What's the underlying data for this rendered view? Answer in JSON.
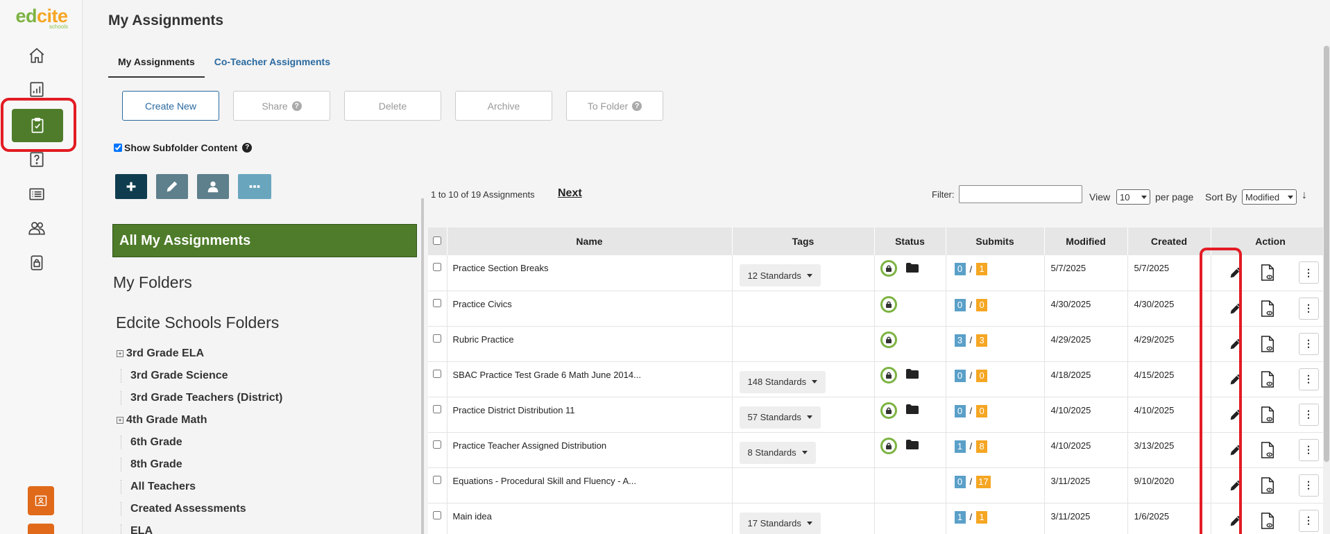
{
  "logo": {
    "part1": "ed",
    "part2": "cite",
    "sub": "schools"
  },
  "page_title": "My Assignments",
  "tabs": [
    {
      "label": "My Assignments"
    },
    {
      "label": "Co-Teacher Assignments"
    }
  ],
  "actions": {
    "create_new": "Create New",
    "share": "Share",
    "delete": "Delete",
    "archive": "Archive",
    "to_folder": "To Folder"
  },
  "subfolder": {
    "label": "Show Subfolder Content",
    "checked": true
  },
  "tools": [
    {
      "icon": "plus-icon",
      "color": "#0f3d4f"
    },
    {
      "icon": "pencil-icon",
      "color": "#5e7f8c"
    },
    {
      "icon": "user-icon",
      "color": "#5e7f8c"
    },
    {
      "icon": "more-icon",
      "color": "#6aa5be"
    }
  ],
  "folders": {
    "all_label": "All My Assignments",
    "my_folders": "My Folders",
    "school_folders": "Edcite Schools Folders",
    "items": [
      {
        "label": "3rd Grade ELA",
        "expandable": true
      },
      {
        "label": "3rd Grade Science",
        "expandable": false
      },
      {
        "label": "3rd Grade Teachers (District)",
        "expandable": false
      },
      {
        "label": "4th Grade Math",
        "expandable": true
      },
      {
        "label": "6th Grade",
        "expandable": false
      },
      {
        "label": "8th Grade",
        "expandable": false
      },
      {
        "label": "All Teachers",
        "expandable": false
      },
      {
        "label": "Created Assessments",
        "expandable": false
      },
      {
        "label": "ELA",
        "expandable": false
      }
    ]
  },
  "pager": {
    "summary": "1 to 10 of 19 Assignments",
    "next": "Next",
    "filter_label": "Filter:",
    "view_label": "View",
    "view_value": "10",
    "per_page": "per page",
    "sort_label": "Sort By",
    "sort_value": "Modified",
    "sort_arrow": "↓"
  },
  "table": {
    "headers": [
      "Name",
      "Tags",
      "Status",
      "Submits",
      "Modified",
      "Created",
      "Action"
    ],
    "rows": [
      {
        "name": "Practice Section Breaks",
        "tags": "12 Standards",
        "lock": true,
        "folder": true,
        "sub_a": "0",
        "sub_b": "1",
        "modified": "5/7/2025",
        "created": "5/7/2025"
      },
      {
        "name": "Practice Civics",
        "tags": "",
        "lock": true,
        "folder": false,
        "sub_a": "0",
        "sub_b": "0",
        "modified": "4/30/2025",
        "created": "4/30/2025"
      },
      {
        "name": "Rubric Practice",
        "tags": "",
        "lock": true,
        "folder": false,
        "sub_a": "3",
        "sub_b": "3",
        "modified": "4/29/2025",
        "created": "4/29/2025"
      },
      {
        "name": "SBAC Practice Test Grade 6 Math June 2014...",
        "tags": "148 Standards",
        "lock": true,
        "folder": true,
        "sub_a": "0",
        "sub_b": "0",
        "modified": "4/18/2025",
        "created": "4/15/2025"
      },
      {
        "name": "Practice District Distribution 11",
        "tags": "57 Standards",
        "lock": true,
        "folder": true,
        "sub_a": "0",
        "sub_b": "0",
        "modified": "4/10/2025",
        "created": "4/10/2025"
      },
      {
        "name": "Practice Teacher Assigned Distribution",
        "tags": "8 Standards",
        "lock": true,
        "folder": true,
        "sub_a": "1",
        "sub_b": "8",
        "modified": "4/10/2025",
        "created": "3/13/2025"
      },
      {
        "name": "Equations - Procedural Skill and Fluency - A...",
        "tags": "",
        "lock": false,
        "folder": false,
        "sub_a": "0",
        "sub_b": "17",
        "modified": "3/11/2025",
        "created": "9/10/2020"
      },
      {
        "name": "Main idea",
        "tags": "17 Standards",
        "lock": false,
        "folder": false,
        "sub_a": "1",
        "sub_b": "1",
        "modified": "3/11/2025",
        "created": "1/6/2025"
      }
    ],
    "submit_sep": "/",
    "more_glyph": "⋮"
  },
  "colors": {
    "accent_green": "#4e7c2a",
    "link_blue": "#2a6aa0",
    "highlight_red": "#e31b23",
    "submit_blue": "#5aa0c8",
    "submit_orange": "#f5a623"
  }
}
